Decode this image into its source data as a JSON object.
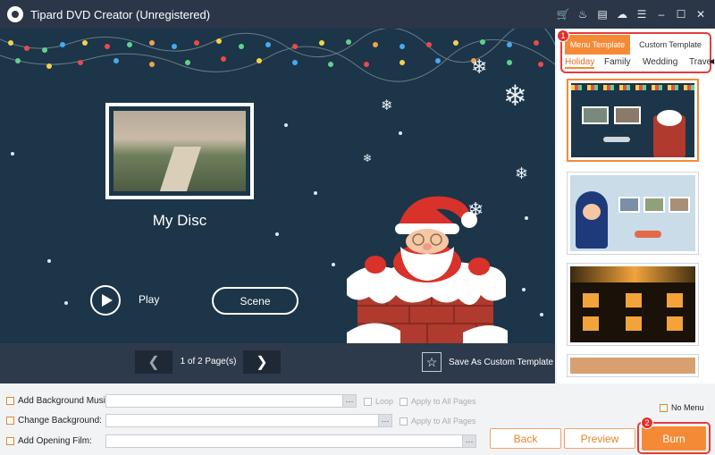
{
  "app": {
    "title": "Tipard DVD Creator (Unregistered)",
    "title_icons": [
      "cart-icon",
      "flame-icon",
      "document-icon",
      "feedback-icon",
      "menu-icon",
      "minimize-icon",
      "maximize-icon",
      "close-icon"
    ]
  },
  "preview": {
    "disc_title": "My Disc",
    "play_label": "Play",
    "scene_label": "Scene",
    "pager_text": "1 of 2 Page(s)",
    "save_template_label": "Save As Custom Template"
  },
  "template_panel": {
    "tabs": [
      "Menu Template",
      "Custom Template"
    ],
    "active_tab": "Menu Template",
    "categories": [
      "Holiday",
      "Family",
      "Wedding",
      "Trave"
    ],
    "active_category": "Holiday",
    "badge_1": "1"
  },
  "options": {
    "bg_music_label": "Add Background Music:",
    "bg_music_value": "",
    "loop_label": "Loop",
    "apply_all_1": "Apply to All Pages",
    "change_bg_label": "Change Background:",
    "change_bg_value": "",
    "apply_all_2": "Apply to All Pages",
    "opening_film_label": "Add Opening Film:",
    "opening_film_value": "",
    "no_menu_label": "No Menu",
    "browse_label": "···"
  },
  "actions": {
    "back": "Back",
    "preview": "Preview",
    "burn": "Burn",
    "badge_2": "2"
  },
  "colors": {
    "accent": "#f58a36",
    "highlight": "#e63b3b",
    "preview_bg": "#1c3548",
    "titlebar_bg": "#2b3648"
  }
}
